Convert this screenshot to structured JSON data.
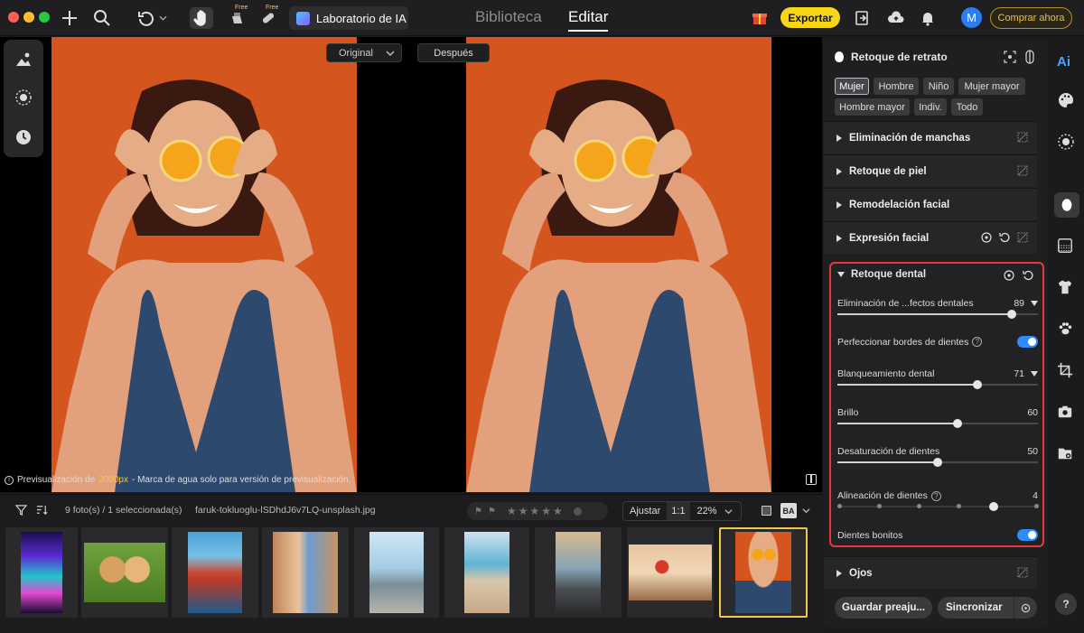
{
  "toolbar": {
    "ai_lab_label": "Laboratorio de IA",
    "tab_library": "Biblioteca",
    "tab_edit": "Editar",
    "export_label": "Exportar",
    "buy_label": "Comprar ahora",
    "avatar_letter": "M",
    "free_badge": "Free"
  },
  "preview": {
    "compare_mode": "Original",
    "after_label": "Después",
    "watermark_prefix": "Previsualización de",
    "watermark_px": "3000px",
    "watermark_suffix": "- Marca de agua solo para versión de previsualización."
  },
  "filmstrip": {
    "count_label": "9 foto(s) / 1 seleccionada(s)",
    "filename": "faruk-tokluoglu-lSDhdJ6v7LQ-unsplash.jpg",
    "fit_label": "Ajustar",
    "ratio_label": "1:1",
    "zoom_label": "22%",
    "ba_label": "BA",
    "rating_stars": 5,
    "thumbnails": [
      {
        "name": "neon-stairs"
      },
      {
        "name": "puppies"
      },
      {
        "name": "harbor-city"
      },
      {
        "name": "street-buildings"
      },
      {
        "name": "city-tower"
      },
      {
        "name": "beach-crowd"
      },
      {
        "name": "seaside-rocks"
      },
      {
        "name": "hot-air-balloon"
      },
      {
        "name": "woman-oranges"
      }
    ]
  },
  "panel": {
    "title": "Retoque de retrato",
    "chips": [
      "Mujer",
      "Hombre",
      "Niño",
      "Mujer mayor",
      "Hombre mayor",
      "Indiv.",
      "Todo"
    ],
    "selected_chip": "Mujer",
    "sections": {
      "blemish": "Eliminación de manchas",
      "skin": "Retoque de piel",
      "reshape": "Remodelación facial",
      "expression": "Expresión facial",
      "dental": "Retoque dental",
      "eyes": "Ojos"
    },
    "dental": {
      "defect_label": "Eliminación de ...fectos dentales",
      "defect_value": "89",
      "edges_label": "Perfeccionar bordes de dientes",
      "edges_on": true,
      "whitening_label": "Blanqueamiento dental",
      "whitening_value": "71",
      "brightness_label": "Brillo",
      "brightness_value": "60",
      "desat_label": "Desaturación de dientes",
      "desat_value": "50",
      "align_label": "Alineación de dientes",
      "align_value": "4",
      "pretty_label": "Dientes bonitos",
      "pretty_on": true
    },
    "save_preset_label": "Guardar preaju...",
    "sync_label": "Sincronizar"
  },
  "rail": {
    "ai_label": "Ai",
    "help_label": "?"
  },
  "colors": {
    "accent": "#2f8cf6",
    "export": "#f7d617",
    "highlight": "#e53a3a",
    "backdrop": "#d4561e"
  }
}
